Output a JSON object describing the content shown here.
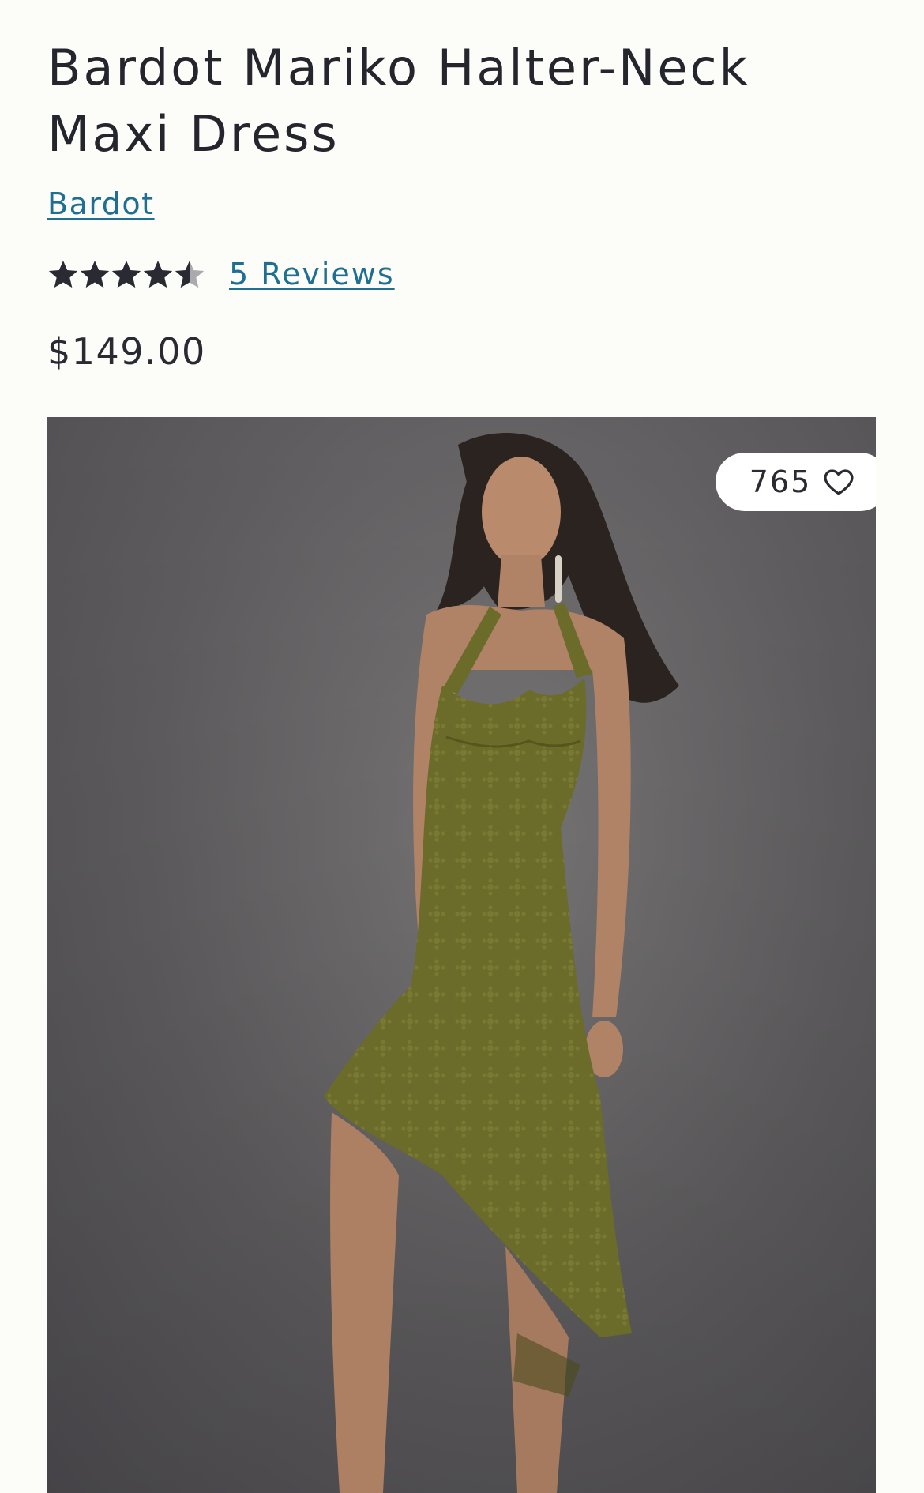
{
  "product": {
    "title_line1": "Bardot Mariko Halter-Neck",
    "title_line2": "Maxi Dress",
    "brand": "Bardot",
    "rating": 4.5,
    "rating_max": 5,
    "reviews_label": "5 Reviews",
    "price": "$149.00"
  },
  "gallery": {
    "like_count": "765",
    "heart_icon": "heart-outline-icon",
    "image_alt": "Model wearing olive green eyelet halter-neck maxi dress"
  },
  "colors": {
    "link": "#1f6f92",
    "star_filled": "#2a2a33",
    "star_empty": "#a9a9ae",
    "dress": "#6b6b2a"
  }
}
